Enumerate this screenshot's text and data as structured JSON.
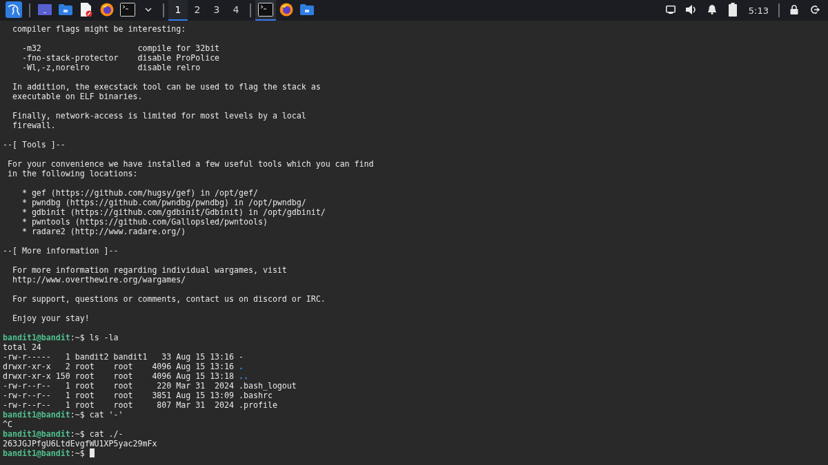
{
  "taskbar": {
    "launchers": [
      {
        "kind": "menu"
      },
      {
        "kind": "desktop"
      },
      {
        "kind": "files"
      },
      {
        "kind": "editor"
      },
      {
        "kind": "browser"
      },
      {
        "kind": "terminal"
      },
      {
        "kind": "more"
      }
    ],
    "workspaces": [
      {
        "label": "1",
        "selected": true
      },
      {
        "label": "2",
        "selected": false
      },
      {
        "label": "3",
        "selected": false
      },
      {
        "label": "4",
        "selected": false
      }
    ],
    "windows": [
      {
        "kind": "terminal",
        "selected": true
      },
      {
        "kind": "browser",
        "selected": false
      },
      {
        "kind": "files",
        "selected": false
      }
    ],
    "tray": [
      {
        "kind": "display"
      },
      {
        "kind": "volume"
      },
      {
        "kind": "notifications"
      },
      {
        "kind": "battery"
      }
    ],
    "clock": "5:13",
    "session": [
      {
        "kind": "lock"
      },
      {
        "kind": "logout"
      }
    ]
  },
  "terminal": {
    "lines": [
      {
        "kind": "text",
        "text": "  compiler flags might be interesting:"
      },
      {
        "kind": "blank"
      },
      {
        "kind": "text",
        "text": "    -m32                    compile for 32bit"
      },
      {
        "kind": "text",
        "text": "    -fno-stack-protector    disable ProPolice"
      },
      {
        "kind": "text",
        "text": "    -Wl,-z,norelro          disable relro"
      },
      {
        "kind": "blank"
      },
      {
        "kind": "text",
        "text": "  In addition, the execstack tool can be used to flag the stack as"
      },
      {
        "kind": "text",
        "text": "  executable on ELF binaries."
      },
      {
        "kind": "blank"
      },
      {
        "kind": "text",
        "text": "  Finally, network-access is limited for most levels by a local"
      },
      {
        "kind": "text",
        "text": "  firewall."
      },
      {
        "kind": "blank"
      },
      {
        "kind": "text",
        "text": "--[ Tools ]--"
      },
      {
        "kind": "blank"
      },
      {
        "kind": "text",
        "text": " For your convenience we have installed a few useful tools which you can find"
      },
      {
        "kind": "text",
        "text": " in the following locations:"
      },
      {
        "kind": "blank"
      },
      {
        "kind": "text",
        "text": "    * gef (https://github.com/hugsy/gef) in /opt/gef/"
      },
      {
        "kind": "text",
        "text": "    * pwndbg (https://github.com/pwndbg/pwndbg) in /opt/pwndbg/"
      },
      {
        "kind": "text",
        "text": "    * gdbinit (https://github.com/gdbinit/Gdbinit) in /opt/gdbinit/"
      },
      {
        "kind": "text",
        "text": "    * pwntools (https://github.com/Gallopsled/pwntools)"
      },
      {
        "kind": "text",
        "text": "    * radare2 (http://www.radare.org/)"
      },
      {
        "kind": "blank"
      },
      {
        "kind": "text",
        "text": "--[ More information ]--"
      },
      {
        "kind": "blank"
      },
      {
        "kind": "text",
        "text": "  For more information regarding individual wargames, visit"
      },
      {
        "kind": "text",
        "text": "  http://www.overthewire.org/wargames/"
      },
      {
        "kind": "blank"
      },
      {
        "kind": "text",
        "text": "  For support, questions or comments, contact us on discord or IRC."
      },
      {
        "kind": "blank"
      },
      {
        "kind": "text",
        "text": "  Enjoy your stay!"
      },
      {
        "kind": "blank"
      },
      {
        "kind": "prompt",
        "user": "bandit1@bandit",
        "path": ":~$",
        "command": "ls -la",
        "cursor": false
      },
      {
        "kind": "text",
        "text": "total 24"
      },
      {
        "kind": "entry",
        "info": "-rw-r-----   1 bandit2 bandit1   33 Aug 15 13:16",
        "name": "-",
        "directory": false
      },
      {
        "kind": "entry",
        "info": "drwxr-xr-x   2 root    root    4096 Aug 15 13:16",
        "name": ".",
        "directory": true
      },
      {
        "kind": "entry",
        "info": "drwxr-xr-x 150 root    root    4096 Aug 15 13:18",
        "name": "..",
        "directory": true
      },
      {
        "kind": "entry",
        "info": "-rw-r--r--   1 root    root     220 Mar 31  2024",
        "name": ".bash_logout",
        "directory": false
      },
      {
        "kind": "entry",
        "info": "-rw-r--r--   1 root    root    3851 Aug 15 13:09",
        "name": ".bashrc",
        "directory": false
      },
      {
        "kind": "entry",
        "info": "-rw-r--r--   1 root    root     807 Mar 31  2024",
        "name": ".profile",
        "directory": false
      },
      {
        "kind": "prompt",
        "user": "bandit1@bandit",
        "path": ":~$",
        "command": "cat '-'",
        "cursor": false
      },
      {
        "kind": "text",
        "text": "^C"
      },
      {
        "kind": "prompt",
        "user": "bandit1@bandit",
        "path": ":~$",
        "command": "cat ./-",
        "cursor": false
      },
      {
        "kind": "text",
        "text": "263JGJPfgU6LtdEvgfWU1XP5yac29mFx"
      },
      {
        "kind": "prompt",
        "user": "bandit1@bandit",
        "path": ":~$",
        "cursor": true
      }
    ]
  }
}
